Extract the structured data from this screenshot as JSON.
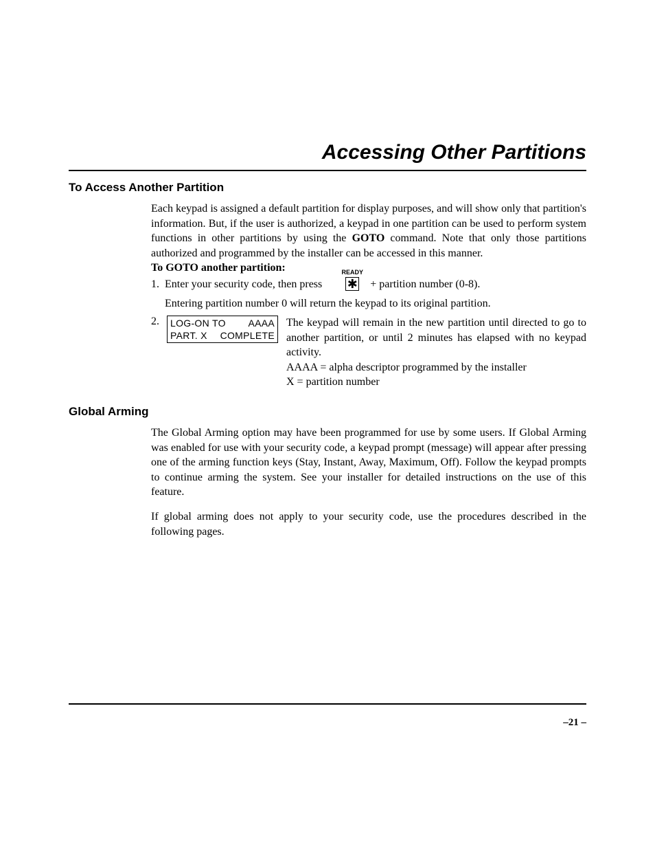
{
  "title": "Accessing Other Partitions",
  "section1": {
    "heading": "To Access Another Partition",
    "para": "Each keypad is assigned a default partition for display purposes, and will show only that partition's information. But, if the user is authorized, a keypad in one partition can be used to perform system functions in other partitions by using the GOTO command. Note that only those partitions authorized and programmed by the installer can be accessed in this manner.",
    "goto_label": "To GOTO another partition:",
    "step1_num": "1.",
    "step1_text": "Enter your security code, then press",
    "ready": "READY",
    "key_symbol": "✱",
    "after_key": "+ partition number (0-8).",
    "step1_note": "Entering partition number 0 will return the keypad to its original partition.",
    "step2_num": "2.",
    "display_l1_left": "LOG-ON TO",
    "display_l1_right": "AAAA",
    "display_l2_left": "PART. X",
    "display_l2_right": "COMPLETE",
    "step2_para1": "The keypad will remain in the new partition until directed to go to another partition, or until 2 minutes has elapsed with no keypad activity.",
    "step2_para2": "AAAA = alpha descriptor programmed by the installer",
    "step2_para3": "X = partition number"
  },
  "section2": {
    "heading": "Global Arming",
    "para1": "The Global Arming option may have been programmed for use by some users. If Global Arming was enabled for use with your security code, a keypad prompt (message) will appear after pressing one of the arming function keys (Stay, Instant, Away, Maximum, Off). Follow the keypad prompts to continue arming the system. See your installer for detailed instructions on the use of this feature.",
    "para2": "If global arming does not apply to your security code, use the procedures described in the following pages."
  },
  "page_number": "–21 –"
}
